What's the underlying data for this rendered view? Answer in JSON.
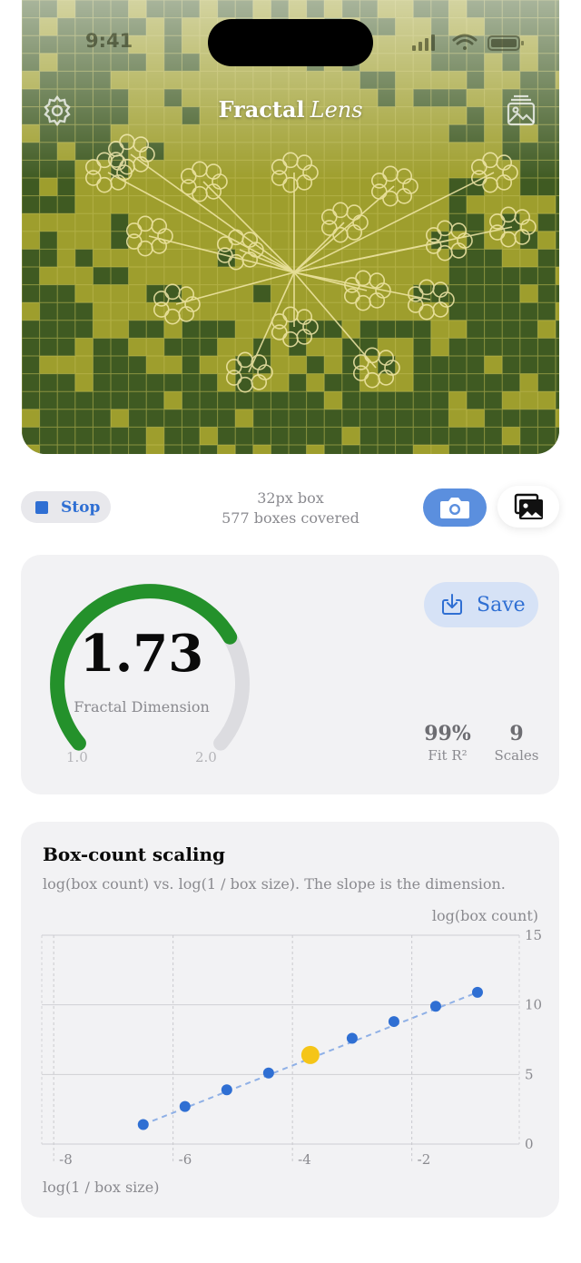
{
  "status_bar": {
    "time": "9:41"
  },
  "header": {
    "title_main": "Fractal",
    "title_accent": "Lens",
    "settings_icon": "gear-icon",
    "gallery_icon": "photo-stack-icon"
  },
  "controls": {
    "stop_label": "Stop",
    "box_size": "32px box",
    "boxes_covered": "577 boxes covered",
    "camera_icon": "camera-icon",
    "gallery_icon": "photos-icon"
  },
  "result": {
    "dimension": "1.73",
    "dimension_label": "Fractal Dimension",
    "gauge_min": "1.0",
    "gauge_max": "2.0",
    "gauge_fraction": 0.73,
    "save_label": "Save",
    "fit_value": "99%",
    "fit_label": "Fit R²",
    "scales_value": "9",
    "scales_label": "Scales"
  },
  "chart_data": {
    "type": "scatter",
    "title": "Box-count scaling",
    "subtitle": "log(box count) vs. log(1 / box size). The slope is the dimension.",
    "xlabel": "log(1 / box size)",
    "ylabel": "log(box count)",
    "xlim": [
      -8.2,
      -0.2
    ],
    "ylim": [
      0,
      15
    ],
    "x_ticks": [
      "-8",
      "-6",
      "-4",
      "-2"
    ],
    "x_tick_values": [
      -8,
      -6,
      -4,
      -2
    ],
    "y_ticks": [
      "0",
      "5",
      "10",
      "15"
    ],
    "y_tick_values": [
      0,
      5,
      10,
      15
    ],
    "points": [
      {
        "x": -6.5,
        "y": 1.4
      },
      {
        "x": -5.8,
        "y": 2.7
      },
      {
        "x": -5.1,
        "y": 3.9
      },
      {
        "x": -4.4,
        "y": 5.1
      },
      {
        "x": -3.7,
        "y": 6.4,
        "highlight": true
      },
      {
        "x": -3.0,
        "y": 7.6
      },
      {
        "x": -2.3,
        "y": 8.8
      },
      {
        "x": -1.6,
        "y": 9.9
      },
      {
        "x": -0.9,
        "y": 10.9
      }
    ],
    "fit_line": {
      "x": [
        -6.5,
        -0.9
      ],
      "y": [
        1.4,
        10.9
      ]
    },
    "point_color": "#2f6fd3",
    "highlight_color": "#f5c518",
    "grid": true
  }
}
